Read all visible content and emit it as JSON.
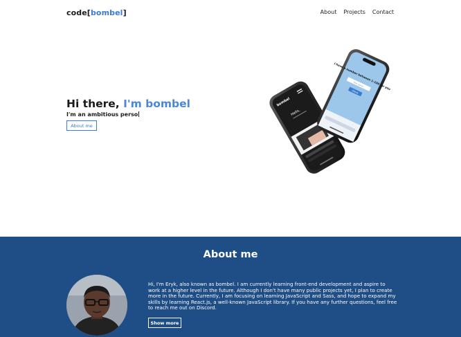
{
  "header": {
    "logo_prefix": "code[",
    "logo_accent": "bombel",
    "logo_suffix": "]",
    "nav": [
      "About",
      "Projects",
      "Contact"
    ]
  },
  "hero": {
    "title_prefix": "Hi there, ",
    "title_accent": "I'm bombel",
    "subtitle": "I'm an ambitious perso",
    "button_label": "About me"
  },
  "phones": {
    "back_screen_heading": "I have a number between 1-100 for you",
    "back_screen_input": "Your guess",
    "back_screen_button": "Check",
    "front_screen_brand": "bombel",
    "front_screen_greeting": "Hello,"
  },
  "about": {
    "title": "About me",
    "text": "Hi, I'm Eryk, also known as bombel. I am currently learning front-end development and aspire to work at a higher level in the future. Although I don't have many public projects yet, I plan to create more in the future. Currently, I am focusing on learning JavaScript and Sass, and hope to expand my skills by learning React.js, a well-known JavaScript library. If you have any further questions, feel free to reach me out on Discord.",
    "button_label": "Show more"
  },
  "colors": {
    "accent": "#3a7bd5",
    "section_background": "#1f4d85"
  }
}
